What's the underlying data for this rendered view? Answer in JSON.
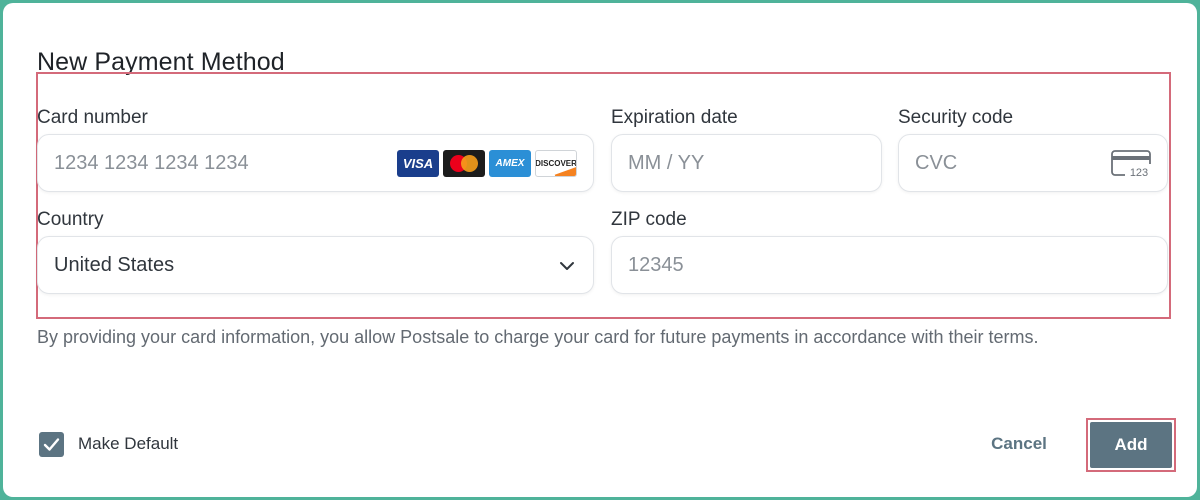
{
  "dialog": {
    "title": "New Payment Method"
  },
  "form": {
    "card_number": {
      "label": "Card number",
      "placeholder": "1234 1234 1234 1234",
      "brands": [
        "VISA",
        "AMEX",
        "DISCOVER"
      ]
    },
    "expiration": {
      "label": "Expiration date",
      "placeholder": "MM / YY"
    },
    "security": {
      "label": "Security code",
      "placeholder": "CVC",
      "icon_text": "123"
    },
    "country": {
      "label": "Country",
      "value": "United States"
    },
    "zip": {
      "label": "ZIP code",
      "placeholder": "12345"
    }
  },
  "disclaimer": "By providing your card information, you allow Postsale to charge your card for future payments in accordance with their terms.",
  "footer": {
    "make_default_label": "Make Default",
    "make_default_checked": true,
    "cancel_label": "Cancel",
    "add_label": "Add"
  },
  "colors": {
    "background": "#4fb39a",
    "primary_button": "#5c7482",
    "highlight_border": "#d46a7a"
  }
}
